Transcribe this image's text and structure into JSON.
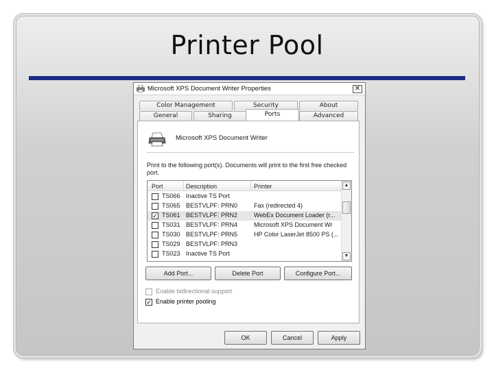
{
  "slide": {
    "title": "Printer Pool",
    "rule_color": "#1a2a86"
  },
  "dialog": {
    "title": "Microsoft XPS Document Writer Properties",
    "close_glyph": "✕",
    "tabs_row1": [
      "Color Management",
      "Security",
      "About"
    ],
    "tabs_row2": [
      "General",
      "Sharing",
      "Ports",
      "Advanced"
    ],
    "active_tab": "Ports",
    "printer_name": "Microsoft XPS Document Writer",
    "instructions": "Print to the following port(s). Documents will print to the first free checked port.",
    "list": {
      "columns": [
        "Port",
        "Description",
        "Printer"
      ],
      "rows": [
        {
          "checked": false,
          "port": "TS066",
          "description": "Inactive TS Port",
          "printer": ""
        },
        {
          "checked": false,
          "port": "TS065",
          "description": "BESTVLPF: PRN0",
          "printer": "Fax (redirected 4)"
        },
        {
          "checked": true,
          "port": "TS061",
          "description": "BESTVLPF: PRN2",
          "printer": "WebEx Document Loader (r..."
        },
        {
          "checked": false,
          "port": "TS031",
          "description": "BESTVLPF: PRN4",
          "printer": "Microsoft XPS Document Wr"
        },
        {
          "checked": false,
          "port": "TS030",
          "description": "BESTVLPF: PRN5",
          "printer": "HP Color LaserJet 8500 PS (..."
        },
        {
          "checked": false,
          "port": "TS029",
          "description": "BESTVLPF: PRN3",
          "printer": ""
        },
        {
          "checked": false,
          "port": "TS023",
          "description": "Inactive TS Port",
          "printer": ""
        }
      ],
      "scroll_up": "▲",
      "scroll_down": "▼"
    },
    "buttons": {
      "add_port": "Add Port...",
      "delete_port": "Delete Port",
      "configure_port": "Configure Port..."
    },
    "options": {
      "bidirectional_label": "Enable bidirectional support",
      "bidirectional_checked": false,
      "pooling_label": "Enable printer pooling",
      "pooling_checked": true
    },
    "footer": {
      "ok": "OK",
      "cancel": "Cancel",
      "apply": "Apply"
    },
    "check_glyph": "✓",
    "icons": {
      "app": "printer-icon",
      "printer": "printer-icon"
    }
  }
}
